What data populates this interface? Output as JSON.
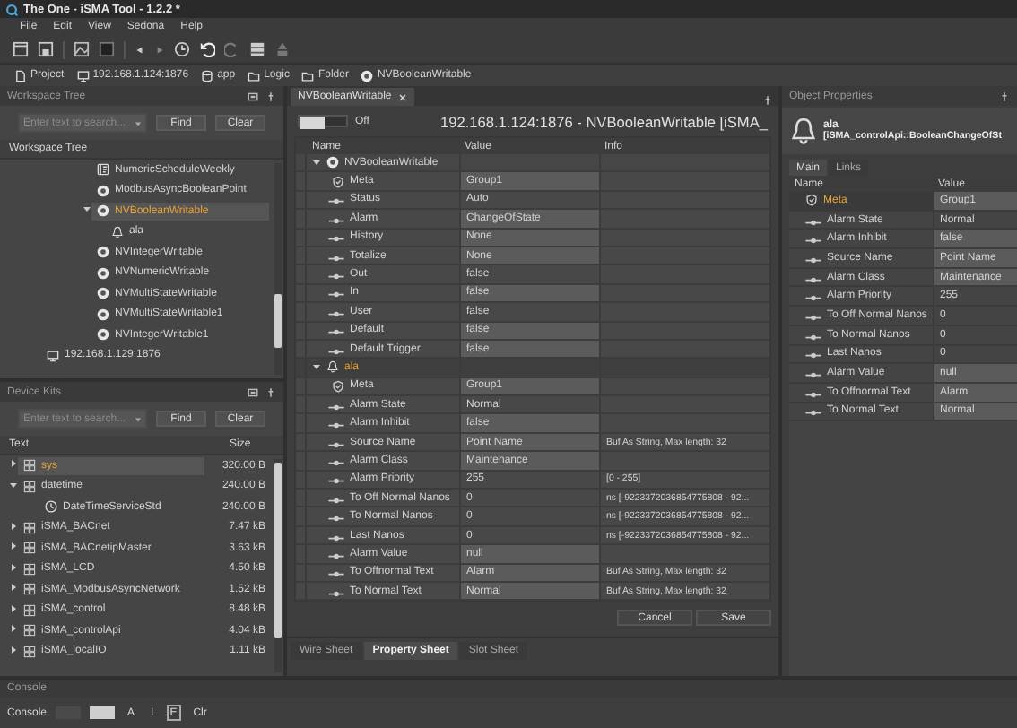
{
  "window": {
    "title": "The One - iSMA Tool - 1.2.2 *"
  },
  "menu": [
    "File",
    "Edit",
    "View",
    "Sedona",
    "Help"
  ],
  "breadcrumb": [
    {
      "label": "Project",
      "kind": "project"
    },
    {
      "label": "192.168.1.124:1876",
      "kind": "device"
    },
    {
      "label": "app",
      "kind": "app"
    },
    {
      "label": "Logic",
      "kind": "folder"
    },
    {
      "label": "Folder",
      "kind": "folder"
    },
    {
      "label": "NVBooleanWritable",
      "kind": "point"
    }
  ],
  "workspace_tree": {
    "title": "Workspace Tree",
    "search": {
      "placeholder": "Enter text to search..."
    },
    "buttons": [
      "Find",
      "Clear"
    ],
    "column": "Workspace Tree",
    "items": [
      {
        "label": "NumericScheduleWeekly",
        "kind": "schedule",
        "selected": false
      },
      {
        "label": "ModbusAsyncBooleanPoint",
        "kind": "point",
        "selected": false
      },
      {
        "label": "NVBooleanWritable",
        "kind": "point",
        "selected": true,
        "expanded": true,
        "children": [
          {
            "label": "ala",
            "kind": "alarm",
            "selected": false
          }
        ]
      },
      {
        "label": "NVIntegerWritable",
        "kind": "point",
        "selected": false
      },
      {
        "label": "NVNumericWritable",
        "kind": "point",
        "selected": false
      },
      {
        "label": "NVMultiStateWritable",
        "kind": "point",
        "selected": false
      },
      {
        "label": "NVMultiStateWritable1",
        "kind": "point",
        "selected": false
      },
      {
        "label": "NVIntegerWritable1",
        "kind": "point",
        "selected": false
      }
    ],
    "root_items": [
      {
        "label": "192.168.1.129:1876",
        "kind": "device",
        "selected": false
      }
    ]
  },
  "device_kits": {
    "title": "Device Kits",
    "search": {
      "placeholder": "Enter text to search..."
    },
    "buttons": [
      "Find",
      "Clear"
    ],
    "columns": [
      "Text",
      "Size"
    ],
    "items": [
      {
        "label": "sys",
        "size": "320.00 B",
        "kind": "kit",
        "selected": true,
        "expanded": false
      },
      {
        "label": "datetime",
        "size": "240.00 B",
        "kind": "kit",
        "selected": false,
        "expanded": true,
        "children": [
          {
            "label": "DateTimeServiceStd",
            "size": "240.00 B",
            "kind": "service",
            "selected": false
          }
        ]
      },
      {
        "label": "iSMA_BACnet",
        "size": "7.47 kB",
        "kind": "kit",
        "selected": false,
        "expanded": false
      },
      {
        "label": "iSMA_BACnetipMaster",
        "size": "3.63 kB",
        "kind": "kit",
        "selected": false,
        "expanded": false
      },
      {
        "label": "iSMA_LCD",
        "size": "4.50 kB",
        "kind": "kit",
        "selected": false,
        "expanded": false
      },
      {
        "label": "iSMA_ModbusAsyncNetwork",
        "size": "1.52 kB",
        "kind": "kit",
        "selected": false,
        "expanded": false
      },
      {
        "label": "iSMA_control",
        "size": "8.48 kB",
        "kind": "kit",
        "selected": false,
        "expanded": false
      },
      {
        "label": "iSMA_controlApi",
        "size": "4.04 kB",
        "kind": "kit",
        "selected": false,
        "expanded": false
      },
      {
        "label": "iSMA_localIO",
        "size": "1.11 kB",
        "kind": "kit",
        "selected": false,
        "expanded": false
      }
    ]
  },
  "editor": {
    "tab": {
      "label": "NVBooleanWritable"
    },
    "toggle": {
      "on": false,
      "label": "Off"
    },
    "heading": "192.168.1.124:1876 - NVBooleanWritable [iSMA_",
    "columns": [
      "Name",
      "Value",
      "Info"
    ],
    "groups": [
      {
        "label": "NVBooleanWritable",
        "kind": "point",
        "expanded": true,
        "selected": false,
        "slots": [
          {
            "name": "Meta",
            "kind": "meta",
            "value": "Group1",
            "editable": true
          },
          {
            "name": "Status",
            "kind": "slot",
            "value": "Auto",
            "editable": false
          },
          {
            "name": "Alarm",
            "kind": "slot",
            "value": "ChangeOfState",
            "editable": true
          },
          {
            "name": "History",
            "kind": "slot",
            "value": "None",
            "editable": true
          },
          {
            "name": "Totalize",
            "kind": "slot",
            "value": "None",
            "editable": true
          },
          {
            "name": "Out",
            "kind": "slot",
            "value": "false",
            "editable": false
          },
          {
            "name": "In",
            "kind": "slot",
            "value": "false",
            "editable": true
          },
          {
            "name": "User",
            "kind": "slot",
            "value": "false",
            "editable": false
          },
          {
            "name": "Default",
            "kind": "slot",
            "value": "false",
            "editable": true
          },
          {
            "name": "Default Trigger",
            "kind": "slot",
            "value": "false",
            "editable": true
          }
        ]
      },
      {
        "label": "ala",
        "kind": "alarm",
        "expanded": true,
        "selected": true,
        "slots": [
          {
            "name": "Meta",
            "kind": "meta",
            "value": "Group1",
            "editable": true
          },
          {
            "name": "Alarm State",
            "kind": "slot",
            "value": "Normal",
            "editable": false
          },
          {
            "name": "Alarm Inhibit",
            "kind": "slot",
            "value": "false",
            "editable": true
          },
          {
            "name": "Source Name",
            "kind": "slot",
            "value": "Point Name",
            "editable": true,
            "info": "Buf As String, Max length: 32"
          },
          {
            "name": "Alarm Class",
            "kind": "slot",
            "value": "Maintenance",
            "editable": true
          },
          {
            "name": "Alarm Priority",
            "kind": "slot",
            "value": "255",
            "editable": false,
            "info": "[0 - 255]"
          },
          {
            "name": "To Off Normal Nanos",
            "kind": "slot",
            "value": "0",
            "editable": false,
            "info": "ns  [-9223372036854775808 - 92..."
          },
          {
            "name": "To Normal Nanos",
            "kind": "slot",
            "value": "0",
            "editable": false,
            "info": "ns  [-9223372036854775808 - 92..."
          },
          {
            "name": "Last Nanos",
            "kind": "slot",
            "value": "0",
            "editable": false,
            "info": "ns  [-9223372036854775808 - 92..."
          },
          {
            "name": "Alarm Value",
            "kind": "slot",
            "value": "null",
            "editable": true
          },
          {
            "name": "To Offnormal Text",
            "kind": "slot",
            "value": "Alarm",
            "editable": true,
            "info": "Buf As String, Max length: 32"
          },
          {
            "name": "To Normal Text",
            "kind": "slot",
            "value": "Normal",
            "editable": true,
            "info": "Buf As String, Max length: 32"
          }
        ]
      }
    ],
    "buttons": [
      "Cancel",
      "Save"
    ],
    "sheets": [
      {
        "label": "Wire Sheet",
        "selected": false
      },
      {
        "label": "Property Sheet",
        "selected": true
      },
      {
        "label": "Slot Sheet",
        "selected": false
      }
    ]
  },
  "object_properties": {
    "title": "Object Properties",
    "object": {
      "name": "ala",
      "type": "[iSMA_controlApi::BooleanChangeOfSt"
    },
    "tabs": [
      {
        "label": "Main",
        "selected": true
      },
      {
        "label": "Links",
        "selected": false
      }
    ],
    "columns": [
      "Name",
      "Value"
    ],
    "rows": [
      {
        "name": "Meta",
        "kind": "meta",
        "value": "Group1",
        "editable": true,
        "selected": true
      },
      {
        "name": "Alarm State",
        "kind": "slot",
        "value": "Normal",
        "editable": false,
        "selected": false
      },
      {
        "name": "Alarm Inhibit",
        "kind": "slot",
        "value": "false",
        "editable": true,
        "selected": false
      },
      {
        "name": "Source Name",
        "kind": "slot",
        "value": "Point Name",
        "editable": true,
        "selected": false
      },
      {
        "name": "Alarm Class",
        "kind": "slot",
        "value": "Maintenance",
        "editable": true,
        "selected": false
      },
      {
        "name": "Alarm Priority",
        "kind": "slot",
        "value": "255",
        "editable": false,
        "selected": false
      },
      {
        "name": "To Off Normal Nanos",
        "kind": "slot",
        "value": "0",
        "editable": false,
        "selected": false
      },
      {
        "name": "To Normal Nanos",
        "kind": "slot",
        "value": "0",
        "editable": false,
        "selected": false
      },
      {
        "name": "Last Nanos",
        "kind": "slot",
        "value": "0",
        "editable": false,
        "selected": false
      },
      {
        "name": "Alarm Value",
        "kind": "slot",
        "value": "null",
        "editable": true,
        "selected": false
      },
      {
        "name": "To Offnormal Text",
        "kind": "slot",
        "value": "Alarm",
        "editable": true,
        "selected": false
      },
      {
        "name": "To Normal Text",
        "kind": "slot",
        "value": "Normal",
        "editable": true,
        "selected": false
      }
    ]
  },
  "console": {
    "title": "Console",
    "label": "Console",
    "filters": [
      {
        "label": "A",
        "selected": false
      },
      {
        "label": "I",
        "selected": false
      },
      {
        "label": "E",
        "selected": true
      }
    ],
    "clear": "Clr"
  }
}
